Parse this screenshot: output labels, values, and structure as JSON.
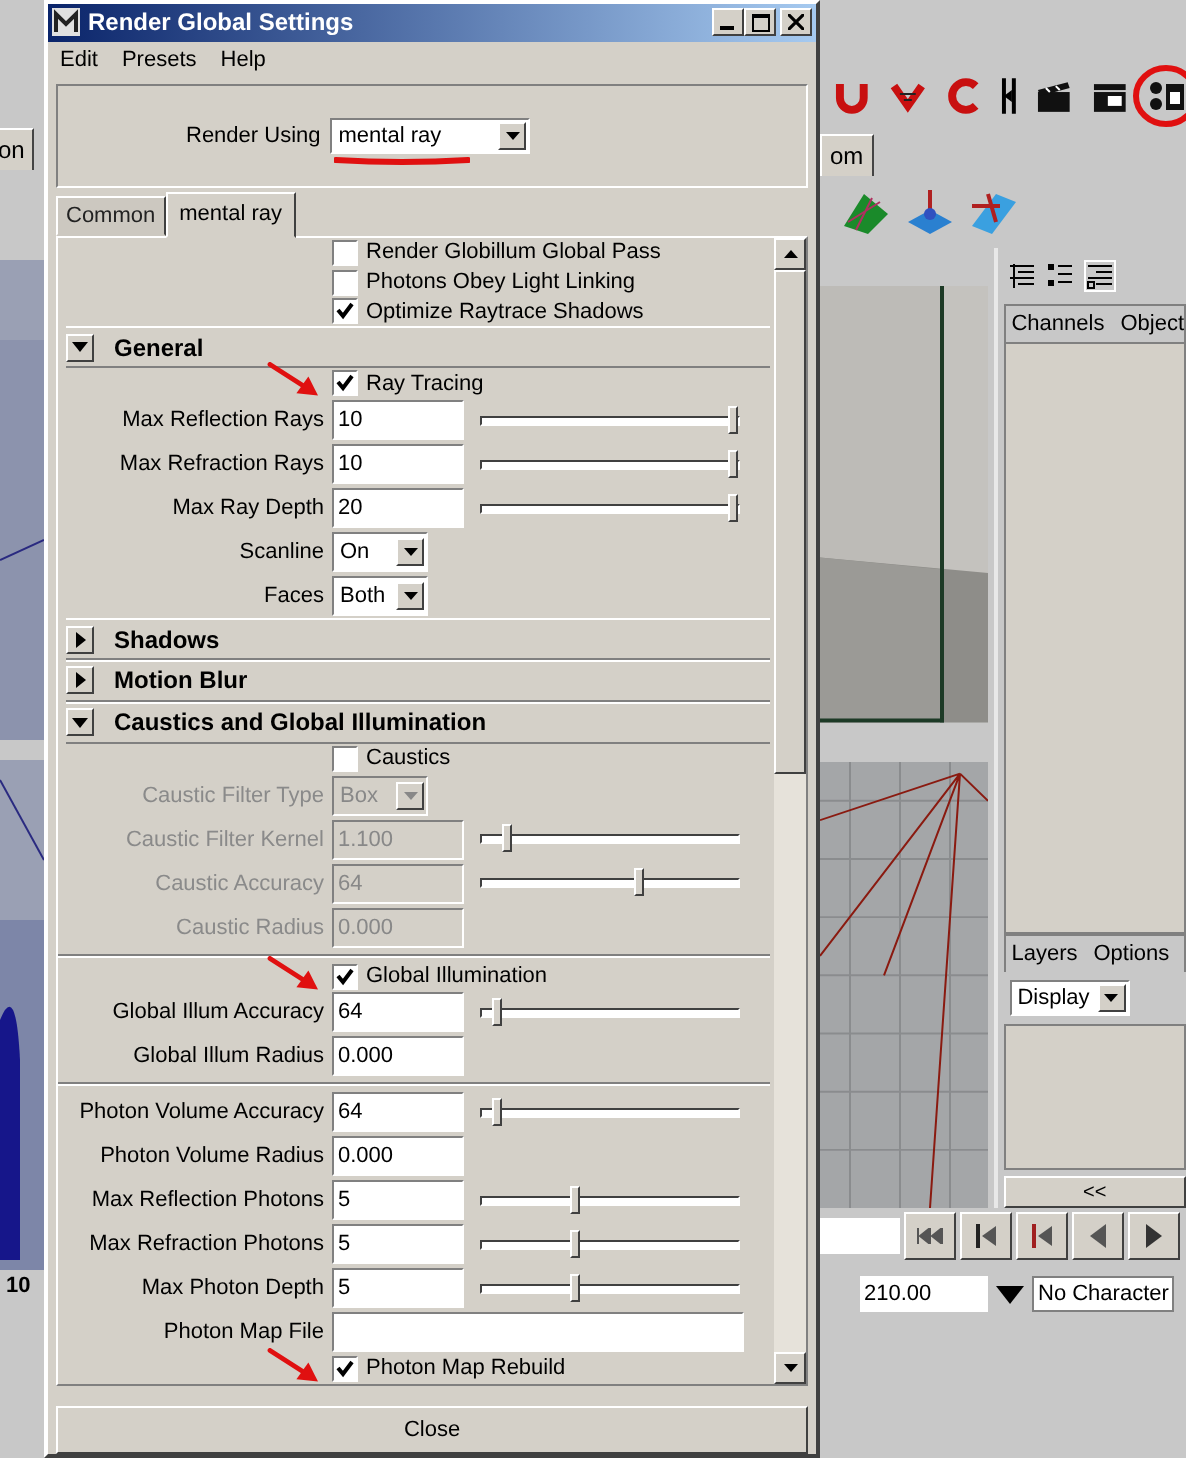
{
  "background": {
    "left_tab": "on",
    "left_frame": "10",
    "right_tab": "om",
    "channel_tabs": [
      "Channels",
      "Object"
    ],
    "layer_menus": [
      "Layers",
      "Options"
    ],
    "layer_dropdown": "Display",
    "scroll_button": "<<",
    "time_field": "210.00",
    "character_field": "No Character"
  },
  "window": {
    "title": "Render Global Settings"
  },
  "menu": [
    "Edit",
    "Presets",
    "Help"
  ],
  "render_using": {
    "label": "Render Using",
    "value": "mental ray",
    "underlined": true
  },
  "tabs": [
    {
      "label": "Common",
      "selected": false
    },
    {
      "label": "mental ray",
      "selected": true
    }
  ],
  "rows": [
    {
      "kind": "checkbox",
      "label": "Render Globillum Global Pass",
      "checked": false,
      "arrow": false
    },
    {
      "kind": "checkbox",
      "label": "Photons Obey Light Linking",
      "checked": false,
      "arrow": false
    },
    {
      "kind": "checkbox",
      "label": "Optimize Raytrace Shadows",
      "checked": true,
      "arrow": false
    },
    {
      "kind": "section",
      "label": "General",
      "expanded": true
    },
    {
      "kind": "checkbox",
      "label": "Ray Tracing",
      "checked": true,
      "arrow": true
    },
    {
      "kind": "field",
      "label": "Max Reflection Rays",
      "value": "10",
      "level": 1,
      "disabled": false
    },
    {
      "kind": "field",
      "label": "Max Refraction Rays",
      "value": "10",
      "level": 1,
      "disabled": false
    },
    {
      "kind": "field",
      "label": "Max Ray Depth",
      "value": "20",
      "level": 1,
      "disabled": false
    },
    {
      "kind": "dropdown",
      "label": "Scanline",
      "value": "On",
      "disabled": false
    },
    {
      "kind": "dropdown",
      "label": "Faces",
      "value": "Both",
      "disabled": false
    },
    {
      "kind": "section",
      "label": "Shadows",
      "expanded": false
    },
    {
      "kind": "section",
      "label": "Motion Blur",
      "expanded": false
    },
    {
      "kind": "section",
      "label": "Caustics and Global Illumination",
      "expanded": true
    },
    {
      "kind": "checkbox",
      "label": "Caustics",
      "checked": false,
      "arrow": false
    },
    {
      "kind": "dropdown",
      "label": "Caustic Filter Type",
      "value": "Box",
      "disabled": true
    },
    {
      "kind": "field",
      "label": "Caustic Filter Kernel",
      "value": "1.100",
      "level": 0.12,
      "disabled": true
    },
    {
      "kind": "field",
      "label": "Caustic Accuracy",
      "value": "64",
      "level": 0.63,
      "disabled": true
    },
    {
      "kind": "field",
      "label": "Caustic Radius",
      "value": "0.000",
      "disabled": true
    },
    {
      "kind": "separator"
    },
    {
      "kind": "checkbox",
      "label": "Global Illumination",
      "checked": true,
      "arrow": true
    },
    {
      "kind": "field",
      "label": "Global Illum Accuracy",
      "value": "64",
      "level": 0.08,
      "disabled": false
    },
    {
      "kind": "field",
      "label": "Global Illum Radius",
      "value": "0.000",
      "disabled": false
    },
    {
      "kind": "separator"
    },
    {
      "kind": "field",
      "label": "Photon Volume Accuracy",
      "value": "64",
      "level": 0.08,
      "disabled": false
    },
    {
      "kind": "field",
      "label": "Photon Volume Radius",
      "value": "0.000",
      "disabled": false
    },
    {
      "kind": "field",
      "label": "Max Reflection Photons",
      "value": "5",
      "level": 0.38,
      "disabled": false
    },
    {
      "kind": "field",
      "label": "Max Refraction Photons",
      "value": "5",
      "level": 0.38,
      "disabled": false
    },
    {
      "kind": "field",
      "label": "Max Photon Depth",
      "value": "5",
      "level": 0.38,
      "disabled": false
    },
    {
      "kind": "file",
      "label": "Photon Map File",
      "value": ""
    },
    {
      "kind": "checkbox",
      "label": "Photon Map Rebuild",
      "checked": true,
      "arrow": true
    }
  ],
  "close_button": "Close"
}
